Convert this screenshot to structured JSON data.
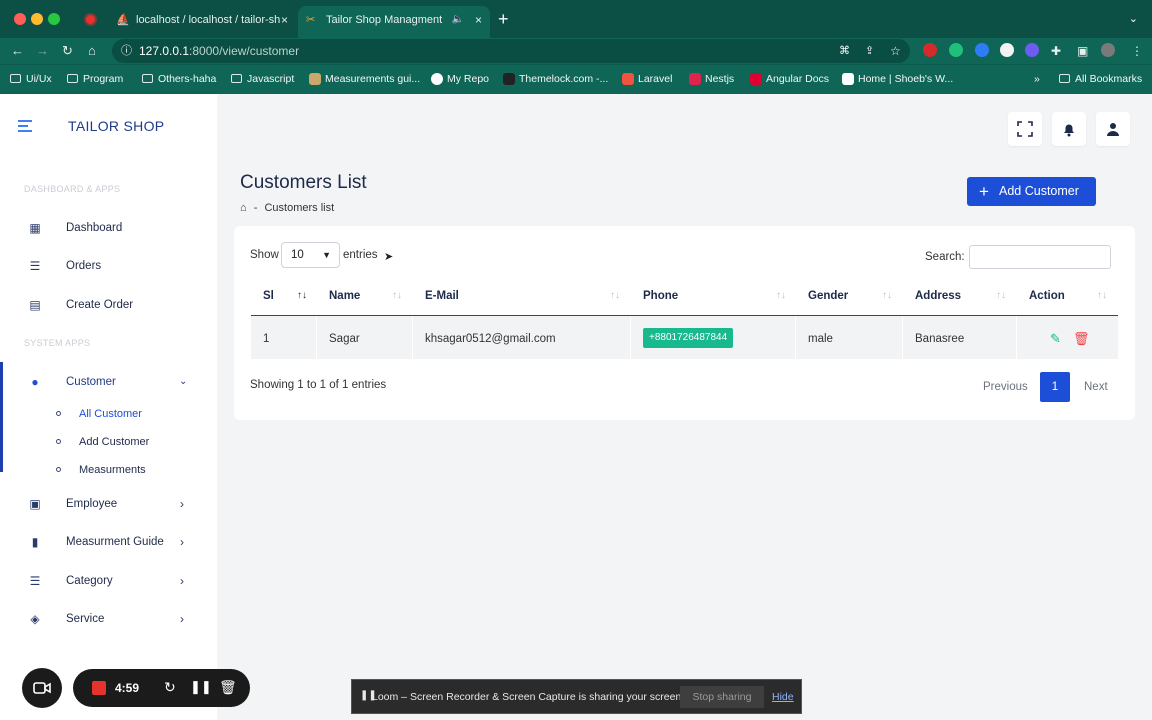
{
  "browser": {
    "tabs": [
      {
        "title": "localhost / localhost / tailor-sh",
        "close": "×"
      },
      {
        "title": "Tailor Shop Managment",
        "close": "×"
      }
    ],
    "new_tab": "+",
    "url_host": "127.0.0.1",
    "url_path": ":8000/view/customer",
    "bookmarks": [
      "Ui/Ux",
      "Program",
      "Others-haha",
      "Javascript",
      "Measurements gui...",
      "My Repo",
      "Themelock.com -...",
      "Laravel",
      "Nestjs",
      "Angular Docs",
      "Home | Shoeb's W..."
    ],
    "more": "»",
    "all_bookmarks": "All Bookmarks"
  },
  "sidebar": {
    "brand": "TAILOR SHOP",
    "section1": "DASHBOARD & APPS",
    "section2": "SYSTEM APPS",
    "items": [
      {
        "label": "Dashboard"
      },
      {
        "label": "Orders"
      },
      {
        "label": "Create Order"
      },
      {
        "label": "Customer"
      },
      {
        "label": "Employee"
      },
      {
        "label": "Measurment Guide"
      },
      {
        "label": "Category"
      },
      {
        "label": "Service"
      }
    ],
    "sub_items": [
      {
        "label": "All Customer"
      },
      {
        "label": "Add Customer"
      },
      {
        "label": "Measurments"
      }
    ]
  },
  "page": {
    "title": "Customers List",
    "breadcrumb_sep": "-",
    "breadcrumb": "Customers list",
    "add_button": "Add Customer"
  },
  "table": {
    "show_label": "Show",
    "page_size": "10",
    "entries_label": "entries",
    "search_label": "Search:",
    "columns": [
      "Sl",
      "Name",
      "E-Mail",
      "Phone",
      "Gender",
      "Address",
      "Action"
    ],
    "rows": [
      {
        "sl": "1",
        "name": "Sagar",
        "email": "khsagar0512@gmail.com",
        "phone": "+8801726487844",
        "gender": "male",
        "address": "Banasree"
      }
    ],
    "info": "Showing 1 to 1 of 1 entries",
    "prev": "Previous",
    "page": "1",
    "next": "Next"
  },
  "loom": {
    "timer": "4:59",
    "message": "Loom – Screen Recorder & Screen Capture is sharing your screen.",
    "stop": "Stop sharing",
    "hide": "Hide"
  }
}
